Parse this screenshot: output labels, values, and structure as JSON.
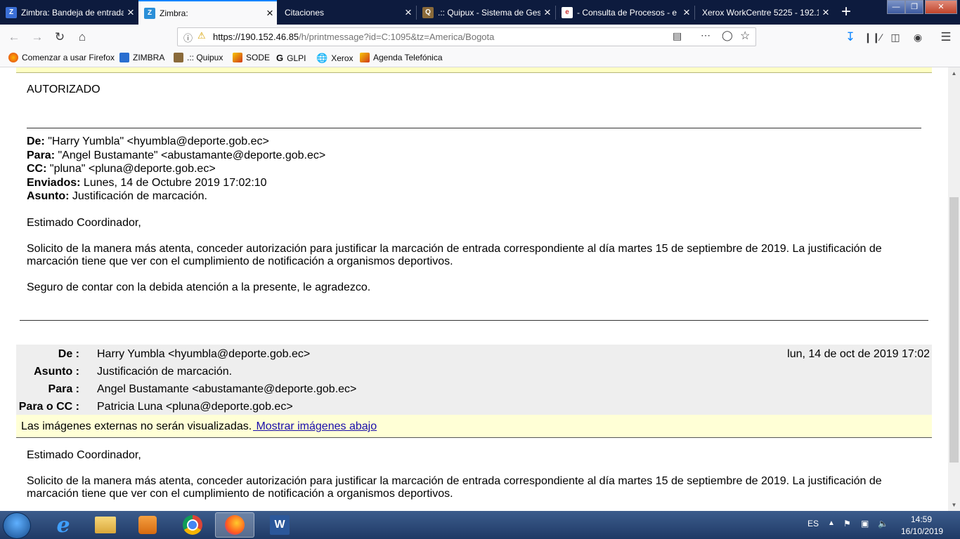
{
  "window": {
    "minimize": "—",
    "maximize": "❐",
    "close": "✕",
    "new_tab": "+"
  },
  "tabs": [
    {
      "title": "Zimbra: Bandeja de entrada",
      "icon": "zimbra-icon",
      "active": false
    },
    {
      "title": "Zimbra:",
      "icon": "zimbra-icon",
      "active": true
    },
    {
      "title": "Citaciones",
      "icon": "",
      "active": false
    },
    {
      "title": ".:: Quipux - Sistema de Gestión",
      "icon": "quipux-icon",
      "active": false
    },
    {
      "title": "- Consulta de Procesos - e",
      "icon": "consulta-icon",
      "active": false
    },
    {
      "title": "Xerox WorkCentre 5225 - 192.1",
      "icon": "",
      "active": false
    }
  ],
  "navbar": {
    "url_host": "https://190.152.46.85",
    "url_path": "/h/printmessage?id=C:1095&tz=America/Bogota"
  },
  "bookmarks": [
    {
      "label": "Comenzar a usar Firefox",
      "icon": "firefox-icon"
    },
    {
      "label": "ZIMBRA",
      "icon": "zimbra-icon"
    },
    {
      "label": ".:: Quipux",
      "icon": "quipux-icon"
    },
    {
      "label": "SODE",
      "icon": "sode-icon"
    },
    {
      "label": "GLPI",
      "icon": "glpi-icon"
    },
    {
      "label": "Xerox",
      "icon": "globe-icon"
    },
    {
      "label": "Agenda Telefónica",
      "icon": "agenda-icon"
    }
  ],
  "message": {
    "reply_text": "AUTORIZADO",
    "quoted": {
      "de_label": "De:",
      "de_value": "\"Harry Yumbla\" <hyumbla@deporte.gob.ec>",
      "para_label": "Para:",
      "para_value": "\"Angel Bustamante\" <abustamante@deporte.gob.ec>",
      "cc_label": "CC:",
      "cc_value": "\"pluna\" <pluna@deporte.gob.ec>",
      "enviados_label": "Enviados:",
      "enviados_value": "Lunes, 14 de Octubre 2019 17:02:10",
      "asunto_label": "Asunto:",
      "asunto_value": "Justificación de marcación.",
      "greeting": "Estimado Coordinador,",
      "body_line1": "Solicito de la manera más atenta, conceder autorización para justificar la marcación de entrada correspondiente al día martes 15 de septiembre de 2019. La justificación de",
      "body_line2": "marcación tiene que ver con el cumplimiento de notificación a organismos deportivos.",
      "closing": "Seguro de contar con la debida atención a la presente, le agradezco."
    },
    "header": {
      "de_label": "De :",
      "de_value": "Harry Yumbla <hyumbla@deporte.gob.ec>",
      "date": "lun, 14 de oct de 2019 17:02",
      "asunto_label": "Asunto :",
      "asunto_value": "Justificación de marcación.",
      "para_label": "Para :",
      "para_value": "Angel Bustamante <abustamante@deporte.gob.ec>",
      "cc_label": "Para o CC :",
      "cc_value": "Patricia Luna <pluna@deporte.gob.ec>"
    },
    "images_notice": "Las imágenes externas no serán visualizadas.",
    "images_link": " Mostrar imágenes abajo",
    "body": {
      "greeting": "Estimado Coordinador,",
      "line1": "Solicito de la manera más atenta, conceder autorización para justificar la marcación de entrada correspondiente al día martes 15 de septiembre de 2019. La justificación de",
      "line2": "marcación tiene que ver con el cumplimiento de notificación a organismos deportivos."
    }
  },
  "taskbar": {
    "lang": "ES",
    "time": "14:59",
    "date": "16/10/2019"
  },
  "colors": {
    "tabstrip": "#0d1b3e",
    "accent": "#0a84ff",
    "link": "#1a0dab",
    "header_bg": "#eeeeee",
    "notice_bg": "#ffffd6"
  }
}
